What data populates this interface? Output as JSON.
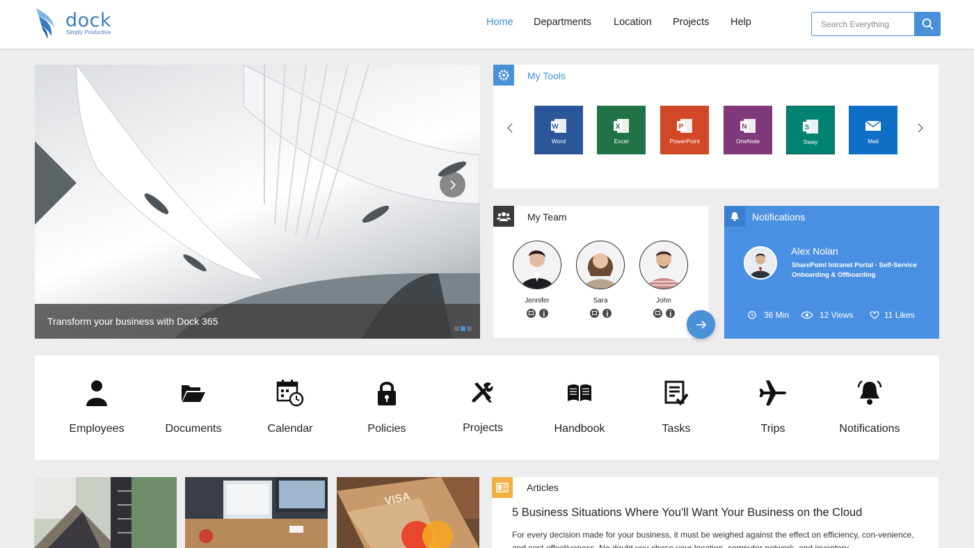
{
  "brand": {
    "name": "dock",
    "tagline": "Simply Productive"
  },
  "nav": {
    "items": [
      "Home",
      "Departments",
      "Location",
      "Projects",
      "Help"
    ],
    "active": "Home"
  },
  "search": {
    "placeholder": "Search Everything"
  },
  "hero": {
    "caption": "Transform your business with Dock 365",
    "slide_count": 3,
    "active_slide": 2
  },
  "tools": {
    "title": "My Tools",
    "items": [
      {
        "label": "Word",
        "color": "#2b579a",
        "icon": "word-icon"
      },
      {
        "label": "Excel",
        "color": "#217346",
        "icon": "excel-icon"
      },
      {
        "label": "PowerPoint",
        "color": "#d24726",
        "icon": "powerpoint-icon"
      },
      {
        "label": "OneNote",
        "color": "#80397b",
        "icon": "onenote-icon"
      },
      {
        "label": "Sway",
        "color": "#008272",
        "icon": "sway-icon"
      },
      {
        "label": "Mail",
        "color": "#0f6fc6",
        "icon": "mail-icon"
      }
    ]
  },
  "team": {
    "title": "My Team",
    "members": [
      {
        "name": "Jennifer"
      },
      {
        "name": "Sara"
      },
      {
        "name": "John"
      }
    ]
  },
  "notifications": {
    "title": "Notifications",
    "author": "Alex Nolan",
    "subtitle": "SharePoint Intranet Portal - Self-Service Onboarding & Offboarding",
    "time": "36 Min",
    "views": "12 Views",
    "likes": "11 Likes",
    "bg_color": "#4a90e2"
  },
  "quick_links": [
    {
      "label": "Employees",
      "icon": "person-icon"
    },
    {
      "label": "Documents",
      "icon": "folder-open-icon"
    },
    {
      "label": "Calendar",
      "icon": "calendar-clock-icon"
    },
    {
      "label": "Policies",
      "icon": "lock-icon"
    },
    {
      "label": "Projects",
      "icon": "tools-icon"
    },
    {
      "label": "Handbook",
      "icon": "book-icon"
    },
    {
      "label": "Tasks",
      "icon": "checklist-icon"
    },
    {
      "label": "Trips",
      "icon": "airplane-icon"
    },
    {
      "label": "Notifications",
      "icon": "bell-icon"
    }
  ],
  "articles": {
    "title": "Articles",
    "headline": "5 Business Situations Where You'll Want Your Business on the Cloud",
    "body": "For every decision made for your business, it must be weighed against the effect on efficiency, con-venience, and cost effectiveness. No doubt you chose your location, computer network, and inventory"
  },
  "colors": {
    "accent": "#4a90d9",
    "tools_badge": "#4a90d9",
    "team_badge": "#3a3a3a",
    "articles_badge": "#f0b044"
  }
}
